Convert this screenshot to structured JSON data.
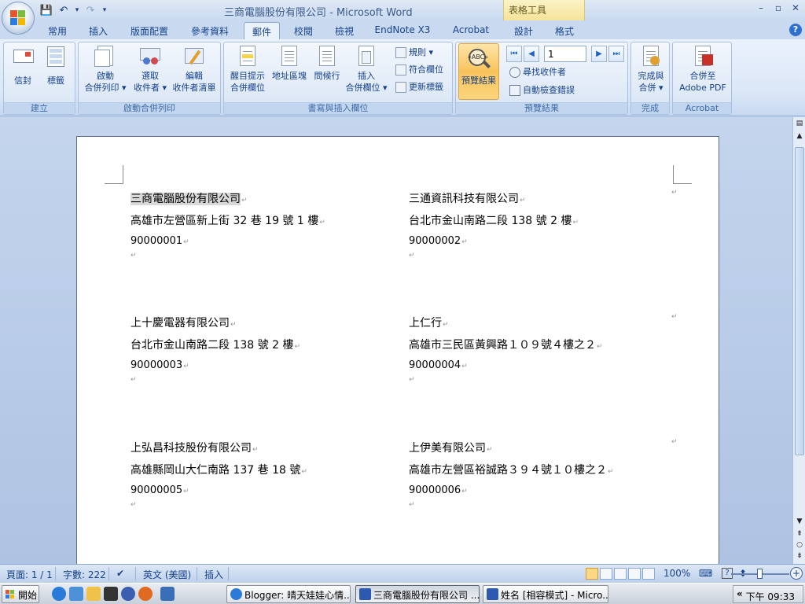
{
  "window": {
    "title": "三商電腦股份有限公司 - Microsoft Word",
    "context_tab_label": "表格工具",
    "controls": [
      "–",
      "▫",
      "✕"
    ]
  },
  "quick_access": [
    "💾",
    "↶",
    "▾",
    "↷",
    "▾"
  ],
  "tabs": [
    {
      "label": "常用"
    },
    {
      "label": "插入"
    },
    {
      "label": "版面配置"
    },
    {
      "label": "參考資料"
    },
    {
      "label": "郵件",
      "active": true
    },
    {
      "label": "校閱"
    },
    {
      "label": "檢視"
    },
    {
      "label": "EndNote X3"
    },
    {
      "label": "Acrobat"
    },
    {
      "label": "設計"
    },
    {
      "label": "格式"
    }
  ],
  "help_label": "?",
  "ribbon": {
    "groups": {
      "create": {
        "caption": "建立",
        "envelopes": "信封",
        "labels": "標籤"
      },
      "start_merge": {
        "caption": "啟動合併列印",
        "start_line1": "啟動",
        "start_line2": "合併列印 ▾",
        "select_line1": "選取",
        "select_line2": "收件者 ▾",
        "edit_line1": "編輯",
        "edit_line2": "收件者清單"
      },
      "write_insert": {
        "caption": "書寫與插入欄位",
        "highlight_line1": "醒目提示",
        "highlight_line2": "合併欄位",
        "address_block": "地址區塊",
        "greeting_line": "問候行",
        "insert_line1": "插入",
        "insert_line2": "合併欄位 ▾",
        "rules": "規則 ▾",
        "match_fields": "符合欄位",
        "update_labels": "更新標籤"
      },
      "preview": {
        "caption": "預覽結果",
        "preview_results": "預覽結果",
        "record_value": "1",
        "find_recipient": "尋找收件者",
        "auto_check": "自動檢查錯誤",
        "abc_badge": "«ABC»"
      },
      "finish": {
        "caption": "完成",
        "finish_line1": "完成與",
        "finish_line2": "合併 ▾"
      },
      "acrobat": {
        "caption": "Acrobat",
        "merge_line1": "合併至",
        "merge_line2": "Adobe PDF"
      }
    }
  },
  "document": {
    "paragraph_mark": "↵",
    "labels": [
      {
        "company": "三商電腦股份有限公司",
        "address": "高雄市左營區新上街 32 巷 19 號 1 樓",
        "code": "90000001"
      },
      {
        "company": "三通資訊科技有限公司",
        "address": "台北市金山南路二段 138 號 2 樓",
        "code": "90000002"
      },
      {
        "company": "上十慶電器有限公司",
        "address": "台北市金山南路二段 138 號 2 樓",
        "code": "90000003"
      },
      {
        "company": "上仁行",
        "address": "高雄市三民區黃興路１０９號４樓之２",
        "code": "90000004"
      },
      {
        "company": "上弘昌科技股份有限公司",
        "address": "高雄縣岡山大仁南路 137 巷 18 號",
        "code": "90000005"
      },
      {
        "company": "上伊美有限公司",
        "address": "高雄市左營區裕誠路３９４號１０樓之２",
        "code": "90000006"
      }
    ]
  },
  "status": {
    "page": "頁面: 1 / 1",
    "words": "字數: 222",
    "language": "英文 (美國)",
    "mode": "插入",
    "zoom": "100%"
  },
  "taskbar": {
    "start": "開始",
    "items": [
      {
        "label": "Blogger: 晴天娃娃心情..."
      },
      {
        "label": "三商電腦股份有限公司 ...",
        "active": true
      },
      {
        "label": "姓名 [相容模式] - Micro..."
      }
    ],
    "tray_chevron": "«",
    "clock": "下午 09:33"
  },
  "colors": {
    "ribbon_blue": "#15428b",
    "active_highlight": "#f9c35b",
    "selection": "#d9d9d9"
  }
}
